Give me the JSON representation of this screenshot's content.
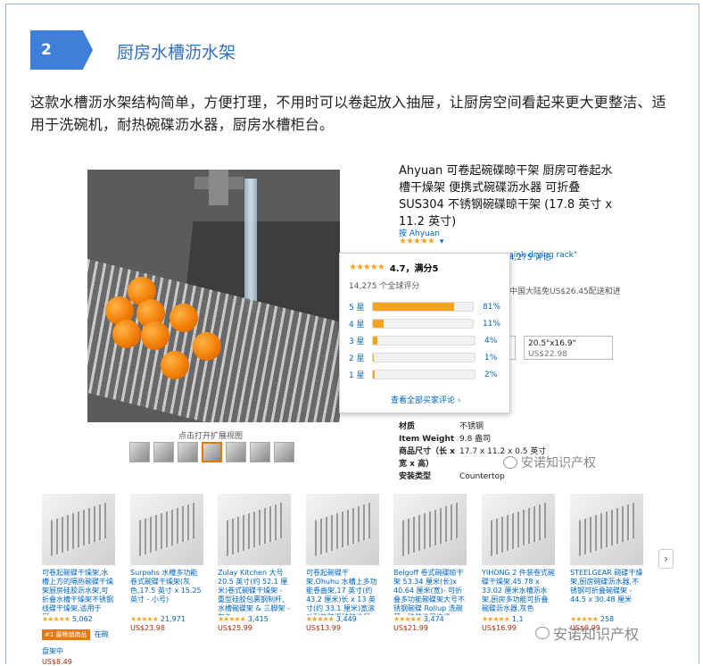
{
  "section": {
    "number": "2",
    "title": "厨房水槽沥水架"
  },
  "intro": "这款水槽沥水架结构简单，方便打理，不用时可以卷起放入抽屉，让厨房空间看起来更大更整洁、适用于洗碗机，耐热碗碟沥水器，厨房水槽柜台。",
  "product": {
    "title": "Ahyuan 可卷起碗碟晾干架 厨房可卷起水槽干燥架 便携式碗碟沥水器 可折叠 SUS304 不锈钢碗碟晾干架 (17.8 英寸 x 11.2 英寸)",
    "by_label": "按 Ahyuan",
    "rating_count": "14,275 评论",
    "rating_link_snippet": "sink drying rack\"",
    "ship_note": "中国大陆免US$26.45配送和进",
    "size_option": {
      "label": "20.5\"x16.9\"",
      "price": "US$22.98"
    },
    "thumb_caption": "点击打开扩展视图",
    "specs": [
      {
        "k": "材质",
        "v": "不锈钢"
      },
      {
        "k": "Item Weight",
        "v": "9.8 盎司"
      },
      {
        "k": "商品尺寸（长 x 宽 x 高）",
        "v": "17.7 x 11.2 x 0.5 英寸"
      },
      {
        "k": "安装类型",
        "v": "Countertop"
      }
    ]
  },
  "popover": {
    "score": "4.7，满分5",
    "total": "14,275 个全球评分",
    "rows": [
      {
        "label": "5 星",
        "pct": 81,
        "pct_text": "81%"
      },
      {
        "label": "4 星",
        "pct": 11,
        "pct_text": "11%"
      },
      {
        "label": "3 星",
        "pct": 4,
        "pct_text": "4%"
      },
      {
        "label": "2 星",
        "pct": 1,
        "pct_text": "1%"
      },
      {
        "label": "1 星",
        "pct": 2,
        "pct_text": "2%"
      }
    ],
    "link": "查看全部买家评论 ›"
  },
  "carousel": [
    {
      "name": "可卷起碗碟干燥架,水槽上方的隔热碗碟干燥架厨房硅胶沥水架,可折叠水槽干燥架不锈钢线碟干燥架,适用于厨...",
      "count": "5,062",
      "badge": "#1 最畅销商品",
      "badge_suffix": "在碗盘架中",
      "price": "US$8.49"
    },
    {
      "name": "Surpahs 水槽多功能卷式碗碟干燥架(灰色,17.5 英寸 x 15.25 英寸 - 小号)",
      "count": "21,971",
      "badge": "",
      "badge_suffix": "",
      "price": "US$23.98"
    },
    {
      "name": "Zulay Kitchen 大号 20.5 英寸(约 52.1 厘米)卷式碗碟干燥架 - 重型硅胶包裹钢制杆,水槽碗碟架 & 三脚架 - 灰色",
      "count": "3,415",
      "badge": "",
      "badge_suffix": "",
      "price": "US$25.99"
    },
    {
      "name": "可卷起碗碟干架,Ohuhu 水槽上多功能卷曲架,17 英寸(约 43.2 厘米)长 x 13 英寸(约 33.1 厘米)宽滚动耐热防滑硅胶涂层...",
      "count": "3,449",
      "badge": "",
      "badge_suffix": "",
      "price": "US$13.99"
    },
    {
      "name": "Belgoff 卷式碗碟晾干架 53.34 厘米(长)x 40.64 厘米(宽)- 可折叠多功能碗碟架大号不锈钢碗碟 Rollup 洗碗菜 - 硅胶涂层边缘",
      "count": "3,474",
      "badge": "",
      "badge_suffix": "",
      "price": "US$21.99"
    },
    {
      "name": "YIHONG 2 件装卷式碗碟干燥架,45.78 x 33.02 厘米水槽沥水架,厨房多功能可折叠碗碟沥水器,灰色",
      "count": "1,1",
      "badge": "",
      "badge_suffix": "",
      "price": "US$16.99"
    },
    {
      "name": "STEELGEAR 碗碟干燥架,厨房碗碟沥水器,不锈钢可折叠碗碟架 - 44.5 x 30.48 厘米",
      "count": "258",
      "badge": "",
      "badge_suffix": "",
      "price": "US$9.99"
    }
  ],
  "carousel_next": "›",
  "watermark": "安诺知识产权"
}
